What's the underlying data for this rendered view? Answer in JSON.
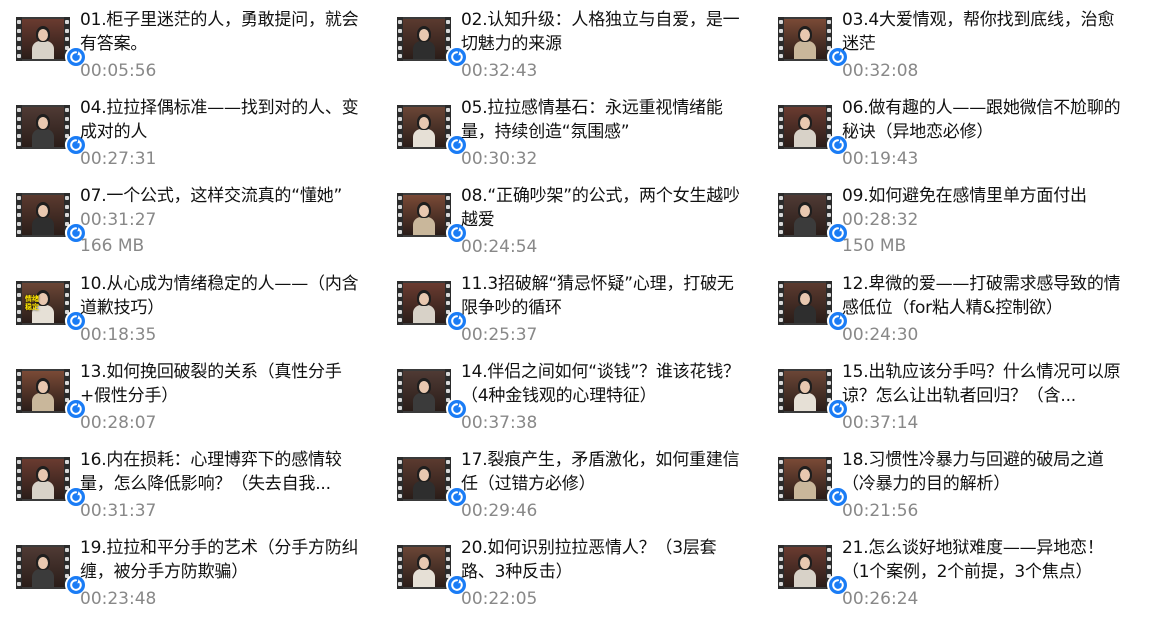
{
  "accent_color": "#1a7cf5",
  "items": [
    {
      "title": "01.柜子里迷茫的人，勇敢提问，就会有答案。",
      "duration": "00:05:56",
      "size": ""
    },
    {
      "title": "02.认知升级：人格独立与自爱，是一切魅力的来源",
      "duration": "00:32:43",
      "size": ""
    },
    {
      "title": "03.4大爱情观，帮你找到底线，治愈迷茫",
      "duration": "00:32:08",
      "size": ""
    },
    {
      "title": "04.拉拉择偶标准——找到对的人、变成对的人",
      "duration": "00:27:31",
      "size": ""
    },
    {
      "title": "05.拉拉感情基石：永远重视情绪能量，持续创造“氛围感”",
      "duration": "00:30:32",
      "size": ""
    },
    {
      "title": "06.做有趣的人——跟她微信不尬聊的秘诀（异地恋必修）",
      "duration": "00:19:43",
      "size": ""
    },
    {
      "title": "07.一个公式，这样交流真的“懂她”",
      "duration": "00:31:27",
      "size": "166 MB"
    },
    {
      "title": "08.“正确吵架”的公式，两个女生越吵越爱",
      "duration": "00:24:54",
      "size": ""
    },
    {
      "title": "09.如何避免在感情里单方面付出",
      "duration": "00:28:32",
      "size": "150 MB"
    },
    {
      "title": "10.从心成为情绪稳定的人——（内含道歉技巧）",
      "duration": "00:18:35",
      "size": "",
      "caption": "情绪稳定"
    },
    {
      "title": "11.3招破解“猜忌怀疑”心理，打破无限争吵的循环",
      "duration": "00:25:37",
      "size": ""
    },
    {
      "title": "12.卑微的爱——打破需求感导致的情感低位（for粘人精&控制欲）",
      "duration": "00:24:30",
      "size": ""
    },
    {
      "title": "13.如何挽回破裂的关系（真性分手+假性分手）",
      "duration": "00:28:07",
      "size": ""
    },
    {
      "title": "14.伴侣之间如何“谈钱”？谁该花钱？（4种金钱观的心理特征）",
      "duration": "00:37:38",
      "size": ""
    },
    {
      "title": "15.出轨应该分手吗？什么情况可以原谅？怎么让出轨者回归？（含...",
      "duration": "00:37:14",
      "size": ""
    },
    {
      "title": "16.内在损耗：心理博弈下的感情较量，怎么降低影响？（失去自我...",
      "duration": "00:31:37",
      "size": ""
    },
    {
      "title": "17.裂痕产生，矛盾激化，如何重建信任（过错方必修）",
      "duration": "00:29:46",
      "size": ""
    },
    {
      "title": "18.习惯性冷暴力与回避的破局之道（冷暴力的目的解析）",
      "duration": "00:21:56",
      "size": ""
    },
    {
      "title": "19.拉拉和平分手的艺术（分手方防纠缠，被分手方防欺骗）",
      "duration": "00:23:48",
      "size": ""
    },
    {
      "title": "20.如何识别拉拉恶情人？（3层套路、3种反击）",
      "duration": "00:22:05",
      "size": ""
    },
    {
      "title": "21.怎么谈好地狱难度——异地恋！（1个案例，2个前提，3个焦点）",
      "duration": "00:26:24",
      "size": ""
    }
  ]
}
